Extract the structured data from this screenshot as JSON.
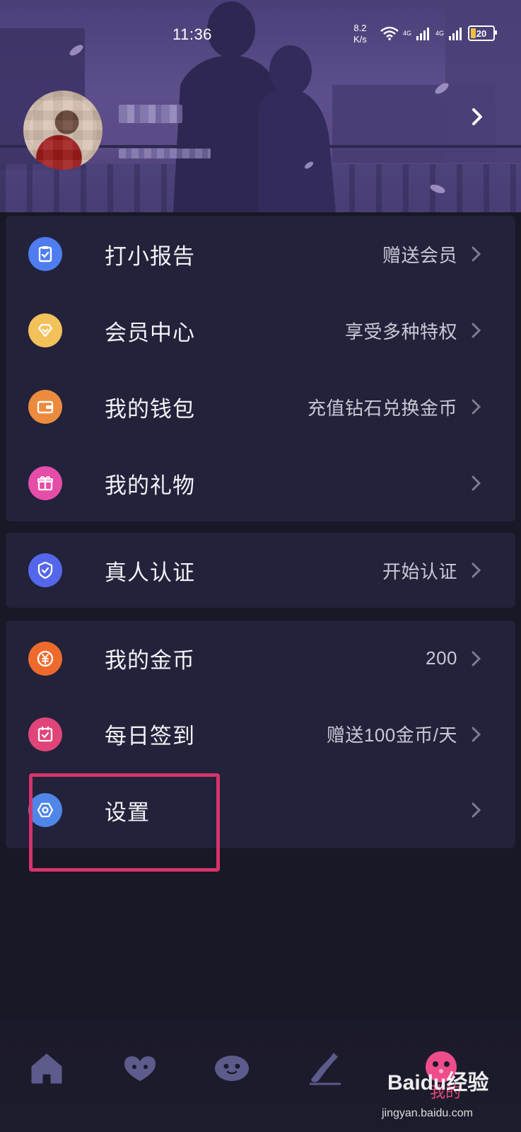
{
  "status_bar": {
    "time": "11:36",
    "net_speed_value": "8.2",
    "net_speed_unit": "K/s",
    "network_1": "4G",
    "network_2": "4G",
    "battery": "20"
  },
  "profile": {
    "avatar": "avatar-pixelated",
    "nickname": "",
    "user_id": "",
    "arrow_icon": "chevron-right-icon"
  },
  "menu_group_1": [
    {
      "label": "打小报告",
      "hint": "赠送会员",
      "icon": "clipboard-check-icon",
      "color": "#4f7df0"
    },
    {
      "label": "会员中心",
      "hint": "享受多种特权",
      "icon": "diamond-icon",
      "color": "#f2c15a"
    },
    {
      "label": "我的钱包",
      "hint": "充值钻石兑换金币",
      "icon": "wallet-icon",
      "color": "#ec8a3e"
    },
    {
      "label": "我的礼物",
      "hint": "",
      "icon": "gift-icon",
      "color": "#e64da8"
    }
  ],
  "menu_group_2": [
    {
      "label": "真人认证",
      "hint": "开始认证",
      "icon": "shield-check-icon",
      "color": "#5467ea"
    }
  ],
  "menu_group_3": [
    {
      "label": "我的金币",
      "hint": "200",
      "icon": "yen-coin-icon",
      "color": "#ee6a2c"
    },
    {
      "label": "每日签到",
      "hint": "赠送100金币/天",
      "icon": "calendar-check-icon",
      "color": "#e0457a"
    },
    {
      "label": "设置",
      "hint": "",
      "icon": "settings-hex-icon",
      "color": "#4f86e8"
    }
  ],
  "bottom_nav": {
    "items": [
      "home-icon",
      "heart-chat-icon",
      "ghost-face-icon",
      "bottle-icon",
      "pink-avatar-icon"
    ],
    "mine_label": "我的"
  },
  "watermark": {
    "brand": "Baidu经验",
    "url": "jingyan.baidu.com"
  },
  "colors": {
    "background": "#181826",
    "card": "#22223a",
    "highlight": "#d6336c",
    "nav_icon": "#5d5a8c"
  }
}
